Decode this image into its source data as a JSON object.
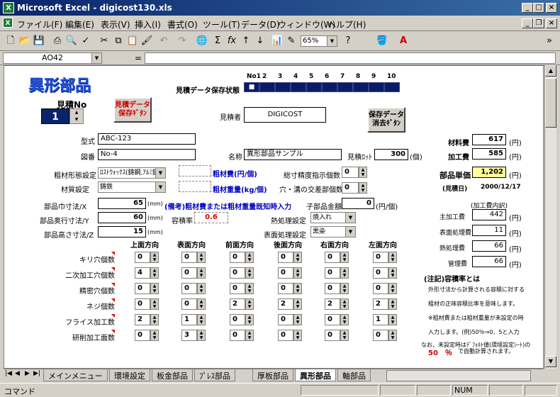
{
  "window": {
    "title": "Microsoft Excel - digicost130.xls",
    "app_icon": "excel-icon",
    "min": "_",
    "max": "□",
    "close": "×"
  },
  "menu": [
    "ファイル(F)",
    "編集(E)",
    "表示(V)",
    "挿入(I)",
    "書式(O)",
    "ツール(T)",
    "データ(D)",
    "ウィンドウ(W)",
    "ヘルプ(H)"
  ],
  "doc_controls": {
    "min": "_",
    "restore": "❐",
    "close": "×"
  },
  "toolbar": {
    "zoom": "65%",
    "more": "»"
  },
  "formula": {
    "namebox": "AO42",
    "equals": "="
  },
  "sheet": {
    "title": "異形部品",
    "save_state_label": "見積データ保存状態",
    "slots": [
      "No1",
      "2",
      "3",
      "4",
      "5",
      "6",
      "7",
      "8",
      "9",
      "10"
    ],
    "slot_marker": "■",
    "mitsumori_no_label": "見積No",
    "mitsumori_no": "1",
    "save_button": "見積データ\n保存ｷﾞﾀﾝ",
    "delete_button": "保存データ\n消去ｷﾞﾀﾝ",
    "estimator_label": "見積者",
    "estimator": "DIGICOST",
    "model_label": "型式",
    "model": "ABC-123",
    "drawing_label": "図番",
    "drawing": "No-4",
    "name_label": "名称",
    "name": "異形部品サンプル",
    "lot_label": "見積ﾛｯﾄ",
    "lot": "300",
    "lot_unit": "(個)",
    "material_cost_label": "材料費",
    "material_cost": "617",
    "processing_cost_label": "加工費",
    "processing_cost": "585",
    "unit_price_label": "部品単価",
    "unit_price": "1,202",
    "yen": "(円)",
    "estimate_date_label": "(見積日)",
    "estimate_date": "2000/12/17",
    "material_form_label": "粗材形態設定",
    "material_form": "ﾛｽﾄｳｫｯｸｽ(鋳鋼,ｱﾙﾐ鋳",
    "material_label": "材質設定",
    "material": "鋳鉄",
    "raw_cost_label": "粗材費(円/個)",
    "raw_weight_label": "粗材重量(kg/個)",
    "precision_label": "総寸精度指示個数",
    "precision_count": "0",
    "hole_label": "穴・溝の交差部個数",
    "hole_count": "0",
    "size_x_label": "部品巾寸法/X",
    "size_x": "65",
    "size_y_label": "部品奥行寸法/Y",
    "size_y": "60",
    "size_z_label": "部品高さ寸法/Z",
    "size_z": "15",
    "mm": "(mm)",
    "note_blue": "(備考)粗材費または粗材重量既知時入力",
    "child_part_label": "子部品金額",
    "child_part": "0",
    "child_part_unit": "(円/個)",
    "volume_rate_label": "容積率",
    "volume_rate": "0.6",
    "heat_label": "熱処理設定",
    "heat": "焼入れ",
    "surface_label": "表面処理設定",
    "surface": "黒染",
    "breakdown_title": "(加工費内訳)",
    "breakdown": [
      {
        "label": "主加工費",
        "value": "442",
        "unit": "(円)"
      },
      {
        "label": "表面処理費",
        "value": "11",
        "unit": "(円)"
      },
      {
        "label": "熱処理費",
        "value": "66",
        "unit": "(円)"
      },
      {
        "label": "管理費",
        "value": "66",
        "unit": "(円)"
      }
    ],
    "directions": [
      "上面方向",
      "表面方向",
      "前面方向",
      "後面方向",
      "右面方向",
      "左面方向"
    ],
    "rows": [
      {
        "label": "キリ穴個数",
        "values": [
          "0",
          "0",
          "0",
          "0",
          "0",
          "0"
        ]
      },
      {
        "label": "二次加工穴個数",
        "values": [
          "4",
          "0",
          "0",
          "0",
          "0",
          "0"
        ]
      },
      {
        "label": "精密穴個数",
        "values": [
          "0",
          "0",
          "0",
          "0",
          "0",
          "0"
        ]
      },
      {
        "label": "ネジ個数",
        "values": [
          "0",
          "0",
          "2",
          "2",
          "2",
          "2"
        ]
      },
      {
        "label": "フライス加工数",
        "values": [
          "2",
          "1",
          "0",
          "0",
          "0",
          "1"
        ]
      },
      {
        "label": "研削加工面数",
        "values": [
          "0",
          "3",
          "0",
          "0",
          "0",
          "0"
        ]
      }
    ],
    "note_title": "(注記)容積率とは",
    "note_lines": [
      "外形寸法から計算される容積に対する",
      "粗材の正味容積比率を意味します。",
      "※粗材費または粗材重量が未設定の時",
      "入力します。(例)50％⇒0．5と入力",
      "なお、未設定時はﾃﾞﾌｫﾙﾄ値(環境設定ｼｰﾄ)の"
    ],
    "note_percent": "50　％",
    "note_tail": "で自動計算されます。"
  },
  "tabs": [
    "メインメニュー",
    "環境設定",
    "板金部品",
    "ﾌﾟﾚｽ部品",
    "厚板部品",
    "異形部品",
    "軸部品"
  ],
  "active_tab": "異形部品",
  "status": {
    "mode": "コマンド",
    "num": "NUM"
  }
}
